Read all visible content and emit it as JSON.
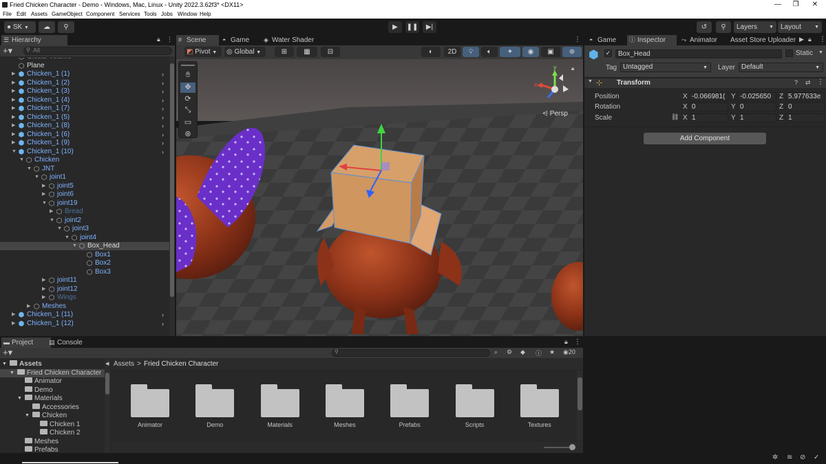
{
  "window": {
    "title": "Fried Chicken Character - Demo - Windows, Mac, Linux - Unity 2022.3.62f3* <DX11>",
    "minimize": "—",
    "maximize": "❐",
    "close": "✕"
  },
  "menu": [
    "File",
    "Edit",
    "Assets",
    "GameObject",
    "Component",
    "Services",
    "Tools",
    "Jobs",
    "Window",
    "Help"
  ],
  "toolbar": {
    "account": "SK",
    "layers": "Layers",
    "layout": "Layout"
  },
  "hierarchy": {
    "tab": "Hierarchy",
    "search_placeholder": "All",
    "rows": [
      {
        "label": "Global Volume",
        "depth": 2,
        "color": "grey",
        "icon": "cube",
        "expand": ""
      },
      {
        "label": "Plane",
        "depth": 2,
        "color": "white",
        "icon": "cube",
        "expand": ""
      },
      {
        "label": "Chicken_1 (1)",
        "depth": 2,
        "color": "blue",
        "icon": "prefab",
        "expand": "▶",
        "more": true
      },
      {
        "label": "Chicken_1 (2)",
        "depth": 2,
        "color": "blue",
        "icon": "prefab",
        "expand": "▶",
        "more": true
      },
      {
        "label": "Chicken_1 (3)",
        "depth": 2,
        "color": "blue",
        "icon": "prefab",
        "expand": "▶",
        "more": true
      },
      {
        "label": "Chicken_1 (4)",
        "depth": 2,
        "color": "blue",
        "icon": "prefab",
        "expand": "▶",
        "more": true
      },
      {
        "label": "Chicken_1 (7)",
        "depth": 2,
        "color": "blue",
        "icon": "prefab",
        "expand": "▶",
        "more": true
      },
      {
        "label": "Chicken_1 (5)",
        "depth": 2,
        "color": "blue",
        "icon": "prefab",
        "expand": "▶",
        "more": true
      },
      {
        "label": "Chicken_1 (8)",
        "depth": 2,
        "color": "blue",
        "icon": "prefab",
        "expand": "▶",
        "more": true
      },
      {
        "label": "Chicken_1 (6)",
        "depth": 2,
        "color": "blue",
        "icon": "prefab",
        "expand": "▶",
        "more": true
      },
      {
        "label": "Chicken_1 (9)",
        "depth": 2,
        "color": "blue",
        "icon": "prefab",
        "expand": "▶",
        "more": true
      },
      {
        "label": "Chicken_1 (10)",
        "depth": 2,
        "color": "blue",
        "icon": "prefab",
        "expand": "▼",
        "more": true
      },
      {
        "label": "Chicken",
        "depth": 3,
        "color": "blue",
        "icon": "cube",
        "expand": "▼"
      },
      {
        "label": "JNT",
        "depth": 4,
        "color": "blue",
        "icon": "cube",
        "expand": "▼"
      },
      {
        "label": "joint1",
        "depth": 5,
        "color": "blue",
        "icon": "cube",
        "expand": "▼"
      },
      {
        "label": "joint5",
        "depth": 6,
        "color": "blue",
        "icon": "cube",
        "expand": "▶"
      },
      {
        "label": "joint6",
        "depth": 6,
        "color": "blue",
        "icon": "cube",
        "expand": "▶"
      },
      {
        "label": "joint19",
        "depth": 6,
        "color": "blue",
        "icon": "cube",
        "expand": "▼"
      },
      {
        "label": "Bread",
        "depth": 7,
        "color": "dim",
        "icon": "cube",
        "expand": "▶"
      },
      {
        "label": "joint2",
        "depth": 7,
        "color": "blue",
        "icon": "cube",
        "expand": "▼"
      },
      {
        "label": "joint3",
        "depth": 8,
        "color": "blue",
        "icon": "cube",
        "expand": "▼"
      },
      {
        "label": "joint4",
        "depth": 9,
        "color": "blue",
        "icon": "cube",
        "expand": "▼"
      },
      {
        "label": "Box_Head",
        "depth": 10,
        "color": "white",
        "icon": "cube",
        "expand": "▼",
        "selected": true
      },
      {
        "label": "Box1",
        "depth": 11,
        "color": "blue",
        "icon": "cube",
        "expand": ""
      },
      {
        "label": "Box2",
        "depth": 11,
        "color": "blue",
        "icon": "cube",
        "expand": ""
      },
      {
        "label": "Box3",
        "depth": 11,
        "color": "blue",
        "icon": "cube",
        "expand": ""
      },
      {
        "label": "joint11",
        "depth": 6,
        "color": "blue",
        "icon": "cube",
        "expand": "▶"
      },
      {
        "label": "joint12",
        "depth": 6,
        "color": "blue",
        "icon": "cube",
        "expand": "▶"
      },
      {
        "label": "Wings",
        "depth": 6,
        "color": "dim",
        "icon": "cube",
        "expand": "▶"
      },
      {
        "label": "Meshes",
        "depth": 4,
        "color": "blue",
        "icon": "cube",
        "expand": "▶"
      },
      {
        "label": "Chicken_1 (11)",
        "depth": 2,
        "color": "blue",
        "icon": "prefab",
        "expand": "▶",
        "more": true
      },
      {
        "label": "Chicken_1 (12)",
        "depth": 2,
        "color": "blue",
        "icon": "prefab",
        "expand": "▶",
        "more": true
      }
    ]
  },
  "scene": {
    "tabs": [
      "Scene",
      "Game",
      "Water Shader"
    ],
    "pivot": "Pivot",
    "global": "Global",
    "mode_2d": "2D",
    "persp": "Persp",
    "gizmo_y": "y",
    "gizmo_x": "x"
  },
  "inspector": {
    "tabs": [
      "Game",
      "Inspector",
      "Animator",
      "Asset Store Uploader"
    ],
    "object_name": "Box_Head",
    "static_label": "Static",
    "tag_label": "Tag",
    "tag_value": "Untagged",
    "layer_label": "Layer",
    "layer_value": "Default",
    "component": "Transform",
    "position_label": "Position",
    "rotation_label": "Rotation",
    "scale_label": "Scale",
    "position": {
      "x": "-0.066981(",
      "y": "-0.025650",
      "z": "5.977633e"
    },
    "rotation": {
      "x": "0",
      "y": "0",
      "z": "0"
    },
    "scale": {
      "x": "1",
      "y": "1",
      "z": "1"
    },
    "add_component": "Add Component"
  },
  "project": {
    "tabs": [
      "Project",
      "Console"
    ],
    "breadcrumb_root": "Assets",
    "breadcrumb_sep": ">",
    "breadcrumb_current": "Fried Chicken Character",
    "count": "20",
    "tree": [
      {
        "label": "Assets",
        "depth": 0,
        "expand": "▼",
        "bold": true
      },
      {
        "label": "Fried Chicken Character",
        "depth": 1,
        "expand": "▼",
        "selected": true
      },
      {
        "label": "Animator",
        "depth": 2,
        "expand": ""
      },
      {
        "label": "Demo",
        "depth": 2,
        "expand": ""
      },
      {
        "label": "Materials",
        "depth": 2,
        "expand": "▼"
      },
      {
        "label": "Accessories",
        "depth": 3,
        "expand": ""
      },
      {
        "label": "Chicken",
        "depth": 3,
        "expand": "▼"
      },
      {
        "label": "Chicken 1",
        "depth": 4,
        "expand": ""
      },
      {
        "label": "Chicken 2",
        "depth": 4,
        "expand": ""
      },
      {
        "label": "Meshes",
        "depth": 2,
        "expand": ""
      },
      {
        "label": "Prefabs",
        "depth": 2,
        "expand": ""
      }
    ],
    "folders": [
      "Animator",
      "Demo",
      "Materials",
      "Meshes",
      "Prefabs",
      "Scripts",
      "Textures"
    ]
  }
}
